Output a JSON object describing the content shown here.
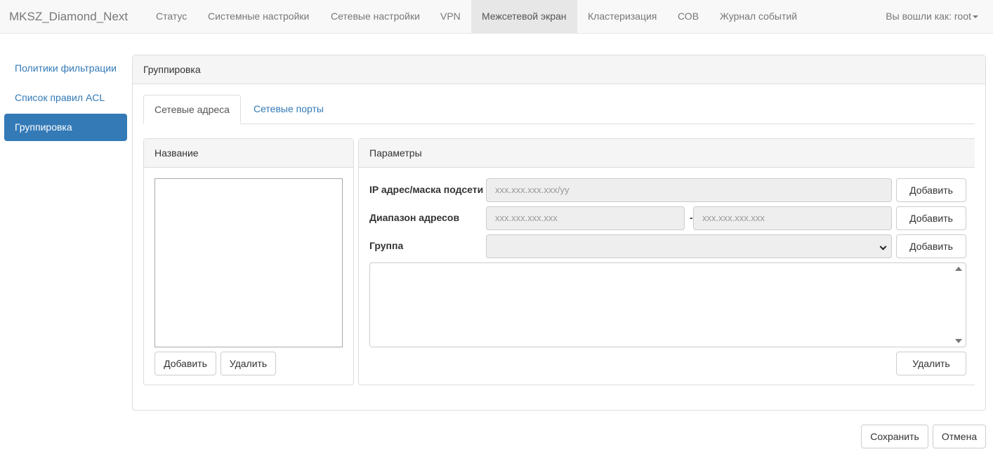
{
  "navbar": {
    "brand": "MKSZ_Diamond_Next",
    "items": [
      {
        "label": "Статус"
      },
      {
        "label": "Системные настройки"
      },
      {
        "label": "Сетевые настройки"
      },
      {
        "label": "VPN"
      },
      {
        "label": "Межсетевой экран",
        "active": true
      },
      {
        "label": "Кластеризация"
      },
      {
        "label": "СОВ"
      },
      {
        "label": "Журнал событий"
      }
    ],
    "user": "Вы вошли как: root"
  },
  "sidebar": {
    "items": [
      {
        "label": "Политики фильтрации"
      },
      {
        "label": "Список правил ACL"
      },
      {
        "label": "Группировка",
        "active": true
      }
    ]
  },
  "main_panel": {
    "title": "Группировка",
    "tabs": [
      {
        "label": "Сетевые адреса",
        "active": true
      },
      {
        "label": "Сетевые порты"
      }
    ]
  },
  "name_panel": {
    "title": "Название",
    "add_label": "Добавить",
    "delete_label": "Удалить"
  },
  "params_panel": {
    "title": "Параметры",
    "ip_label": "IP адрес/маска подсети",
    "ip_placeholder": "xxx.xxx.xxx.xxx/yy",
    "range_label": "Диапазон адресов",
    "range_from_placeholder": "xxx.xxx.xxx.xxx",
    "range_separator": "-",
    "range_to_placeholder": "xxx.xxx.xxx.xxx",
    "group_label": "Группа",
    "add_label": "Добавить",
    "delete_label": "Удалить"
  },
  "footer": {
    "save_label": "Сохранить",
    "cancel_label": "Отмена"
  },
  "colors": {
    "link": "#337ab7",
    "active_sidebar_bg": "#337ab7",
    "navbar_bg": "#f8f8f8",
    "navbar_active_bg": "#e7e7e7",
    "panel_heading_bg": "#f5f5f5",
    "readonly_input_bg": "#eeeeee"
  }
}
